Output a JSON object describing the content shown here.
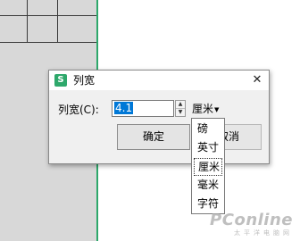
{
  "dialog": {
    "title": "列宽",
    "app_icon_letter": "S",
    "close_glyph": "✕",
    "field_label": "列宽(C):",
    "value": "4.1",
    "unit": "厘米",
    "ok_label": "确定",
    "cancel_label": "取消"
  },
  "unit_options": [
    "磅",
    "英寸",
    "厘米",
    "毫米",
    "字符"
  ],
  "selected_unit": "厘米",
  "watermark": {
    "brand": "PConline",
    "sub": "太平洋电脑网"
  },
  "colors": {
    "accent_green": "#2ea86b",
    "selection_blue": "#0078d7"
  }
}
